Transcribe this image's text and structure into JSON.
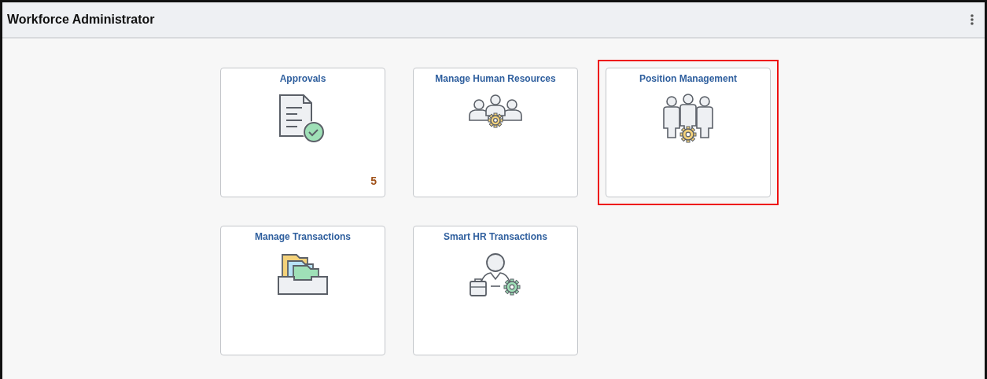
{
  "header": {
    "title": "Workforce Administrator"
  },
  "tiles": [
    {
      "title": "Approvals",
      "kind": "approvals",
      "badge": "5",
      "highlighted": false
    },
    {
      "title": "Manage Human Resources",
      "kind": "people",
      "highlighted": false
    },
    {
      "title": "Position Management",
      "kind": "positions",
      "highlighted": true
    },
    {
      "title": "Manage Transactions",
      "kind": "folders",
      "highlighted": false
    },
    {
      "title": "Smart HR Transactions",
      "kind": "smarthr",
      "highlighted": false
    }
  ]
}
